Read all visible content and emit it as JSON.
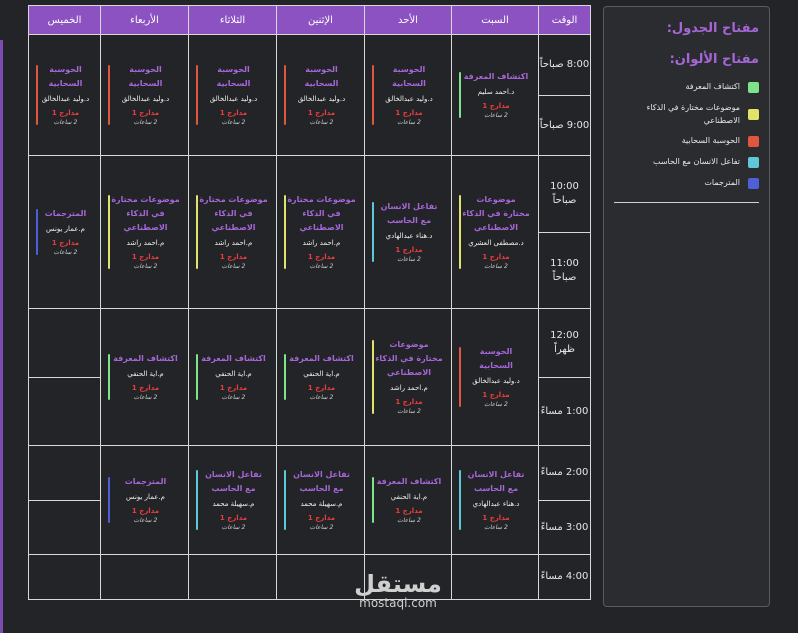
{
  "colors": {
    "header": "#8c52c2",
    "subject": "#a666d8",
    "hall": "#ea3d3d",
    "cat_green": "#7ee38a",
    "cat_yellow": "#e3e36a",
    "cat_red": "#e0563e",
    "cat_cyan": "#5ec8d8",
    "cat_blue": "#4f5fd8"
  },
  "headers": {
    "time": "الوقت",
    "sat": "السبت",
    "sun": "الأحد",
    "mon": "الإثنين",
    "tue": "الثلاثاء",
    "wed": "الأربعاء",
    "thu": "الخميس"
  },
  "times": [
    "8:00 صباحاً",
    "9:00 صباحاً",
    "10:00 صباحاً",
    "11:00 صباحاً",
    "12:00 ظهراً",
    "1:00 مساءً",
    "2:00 مساءً",
    "3:00 مساءً",
    "4:00 مساءً"
  ],
  "entries": {
    "r1_sat": {
      "subject": "اكتشاف المعرفة",
      "teacher": "د.احمد سليم",
      "hall": "مدارج 1",
      "duration": "2 ساعات"
    },
    "r1_sun": {
      "subject": "الحوسبة السحابية",
      "teacher": "د.وليد عبدالخالق",
      "hall": "مدارج 1",
      "duration": "2 ساعات"
    },
    "r1_mon": {
      "subject": "الحوسبة السحابية",
      "teacher": "د.وليد عبدالخالق",
      "hall": "مدارج 1",
      "duration": "2 ساعات"
    },
    "r1_tue": {
      "subject": "الحوسبة السحابية",
      "teacher": "د.وليد عبدالخالق",
      "hall": "مدارج 1",
      "duration": "2 ساعات"
    },
    "r1_wed": {
      "subject": "الحوسبة السحابية",
      "teacher": "د.وليد عبدالخالق",
      "hall": "مدارج 1",
      "duration": "2 ساعات"
    },
    "r1_thu": {
      "subject": "الحوسبة السحابية",
      "teacher": "د.وليد عبدالخالق",
      "hall": "مدارج 1",
      "duration": "2 ساعات"
    },
    "r3_sat": {
      "subject": "موضوعات مختارة في الذكاء الاصطناعي",
      "teacher": "د.مصطفى العشري",
      "hall": "مدارج 1",
      "duration": "2 ساعات"
    },
    "r3_sun": {
      "subject": "تفاعل الانسان مع الحاسب",
      "teacher": "د.هناء عبدالهادي",
      "hall": "مدارج 1",
      "duration": "2 ساعات"
    },
    "r3_mon": {
      "subject": "موضوعات مختارة في الذكاء الاصطناعي",
      "teacher": "م.احمد راشد",
      "hall": "مدارج 1",
      "duration": "2 ساعات"
    },
    "r3_tue": {
      "subject": "موضوعات مختارة في الذكاء الاصطناعي",
      "teacher": "م.احمد راشد",
      "hall": "مدارج 1",
      "duration": "2 ساعات"
    },
    "r3_wed": {
      "subject": "موضوعات مختارة في الذكاء الاصطناعي",
      "teacher": "م.احمد راشد",
      "hall": "مدارج 1",
      "duration": "2 ساعات"
    },
    "r3_thu": {
      "subject": "المترجمات",
      "teacher": "م.عمار يونس",
      "hall": "مدارج 1",
      "duration": "2 ساعات"
    },
    "r5_sat": {
      "subject": "الحوسبة السحابية",
      "teacher": "د.وليد عبدالخالق",
      "hall": "مدارج 1",
      "duration": "2 ساعات"
    },
    "r5_sun": {
      "subject": "موضوعات مختارة في الذكاء الاصطناعي",
      "teacher": "م.احمد راشد",
      "hall": "مدارج 1",
      "duration": "2 ساعات"
    },
    "r5_mon": {
      "subject": "اكتشاف المعرفة",
      "teacher": "م.اية الحنفي",
      "hall": "مدارج 1",
      "duration": "2 ساعات"
    },
    "r5_tue": {
      "subject": "اكتشاف المعرفة",
      "teacher": "م.اية الحنفي",
      "hall": "مدارج 1",
      "duration": "2 ساعات"
    },
    "r5_wed": {
      "subject": "اكتشاف المعرفة",
      "teacher": "م.اية الحنفي",
      "hall": "مدارج 1",
      "duration": "2 ساعات"
    },
    "r7_sat": {
      "subject": "تفاعل الانسان مع الحاسب",
      "teacher": "د.هناء عبدالهادي",
      "hall": "مدارج 1",
      "duration": "2 ساعات"
    },
    "r7_sun": {
      "subject": "اكتشاف المعرفة",
      "teacher": "م.اية الحنفي",
      "hall": "مدارج 1",
      "duration": "2 ساعات"
    },
    "r7_mon": {
      "subject": "تفاعل الانسان مع الحاسب",
      "teacher": "م.سهيلة محمد",
      "hall": "مدارج 1",
      "duration": "2 ساعات"
    },
    "r7_tue": {
      "subject": "تفاعل الانسان مع الحاسب",
      "teacher": "م.سهيلة محمد",
      "hall": "مدارج 1",
      "duration": "2 ساعات"
    },
    "r7_wed": {
      "subject": "المترجمات",
      "teacher": "م.عمار يونس",
      "hall": "مدارج 1",
      "duration": "2 ساعات"
    }
  },
  "panel": {
    "title": "مفتاح الجدول:",
    "legend_title": "مفتاح الألوان:",
    "legend": [
      {
        "label": "اكتشاف المعرفة",
        "color": "#7ee38a"
      },
      {
        "label": "موضوعات مختارة في الذكاء الاصطناعي",
        "color": "#e3e36a"
      },
      {
        "label": "الحوسبة السحابية",
        "color": "#e0563e"
      },
      {
        "label": "تفاعل الانسان مع الحاسب",
        "color": "#5ec8d8"
      },
      {
        "label": "المترجمات",
        "color": "#4f5fd8"
      }
    ]
  },
  "watermark": {
    "arabic": "مستقل",
    "latin": "mostaql.com"
  }
}
